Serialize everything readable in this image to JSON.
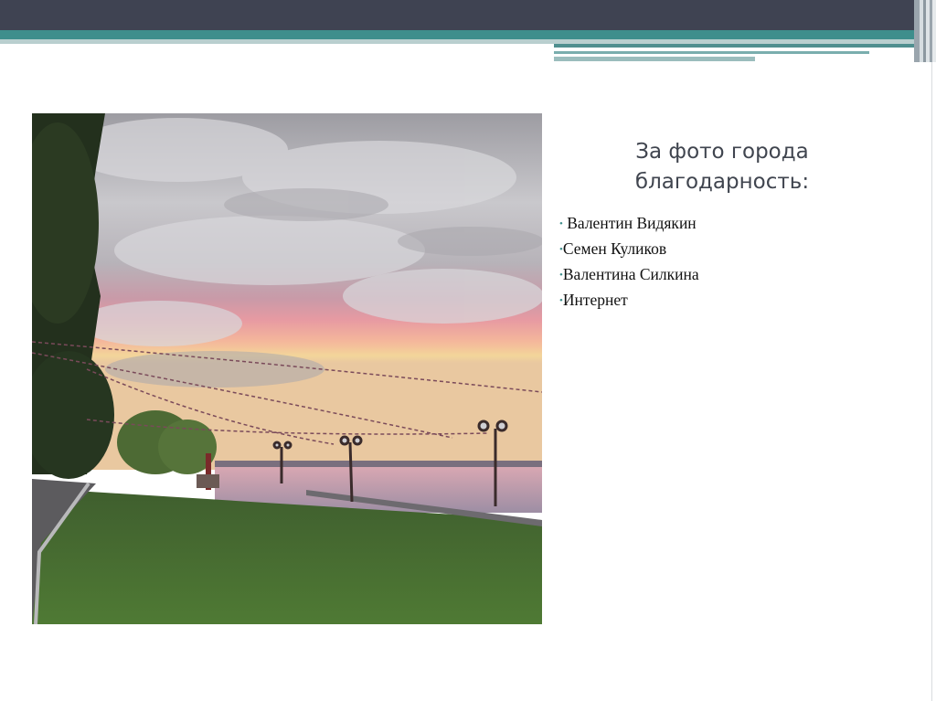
{
  "slide": {
    "title_lines": [
      "За фото города",
      "благодарность:"
    ],
    "credits": [
      {
        "bullet": "•",
        "name": " Валентин Видякин"
      },
      {
        "bullet": "•",
        "name": "Семен Куликов"
      },
      {
        "bullet": "•",
        "name": "Валентина Силкина"
      },
      {
        "bullet": "•",
        "name": "Интернет"
      }
    ]
  },
  "colors": {
    "header_dark": "#3f4352",
    "header_teal": "#3e8e8c",
    "title_text": "#40454f",
    "bullet": "#3e8e8c"
  },
  "icons": {
    "photo": "sunset-embankment-photo"
  }
}
